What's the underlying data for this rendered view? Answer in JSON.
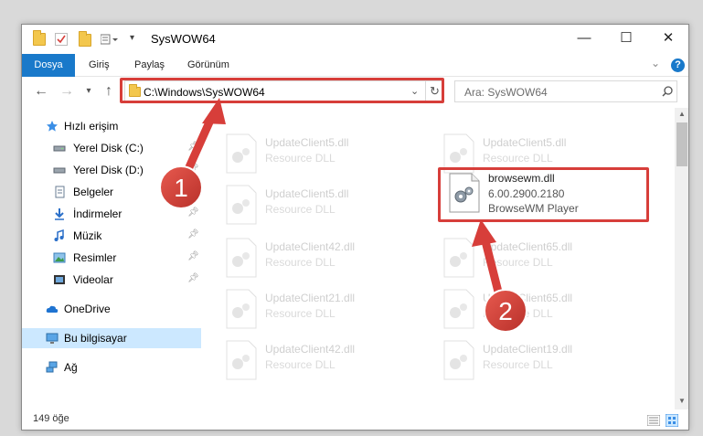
{
  "window": {
    "title": "SysWOW64",
    "minimize": "—",
    "maximize": "☐",
    "close": "✕"
  },
  "ribbon": {
    "tabs": [
      "Dosya",
      "Giriş",
      "Paylaş",
      "Görünüm"
    ],
    "expand": "⌄",
    "help": "?"
  },
  "address": {
    "path": "C:\\Windows\\SysWOW64",
    "search_placeholder": "Ara: SysWOW64"
  },
  "sidebar": {
    "quick_access": "Hızlı erişim",
    "items": [
      {
        "label": "Yerel Disk (C:)",
        "icon": "drive-icon"
      },
      {
        "label": "Yerel Disk (D:)",
        "icon": "drive-icon"
      },
      {
        "label": "Belgeler",
        "icon": "documents-icon"
      },
      {
        "label": "İndirmeler",
        "icon": "download-icon"
      },
      {
        "label": "Müzik",
        "icon": "music-icon"
      },
      {
        "label": "Resimler",
        "icon": "pictures-icon"
      },
      {
        "label": "Videolar",
        "icon": "videos-icon"
      }
    ],
    "onedrive": "OneDrive",
    "this_pc": "Bu bilgisayar",
    "network": "Ağ"
  },
  "files": [
    {
      "name": "UpdateClient5.dll",
      "sub": "Resource DLL"
    },
    {
      "name": "UpdateClient5.dll",
      "sub": "Resource DLL"
    },
    {
      "name": "UpdateClient5.dll",
      "sub": "Resource DLL"
    },
    {
      "name": "UpdateClient42.dll",
      "sub": "Resource DLL"
    },
    {
      "name": "UpdateClient65.dll",
      "sub": "Resource DLL"
    },
    {
      "name": "UpdateClient21.dll",
      "sub": "Resource DLL"
    },
    {
      "name": "UpdateClient65.dll",
      "sub": "Resource DLL"
    },
    {
      "name": "UpdateClient42.dll",
      "sub": "Resource DLL"
    },
    {
      "name": "UpdateClient19.dll",
      "sub": "Resource DLL"
    }
  ],
  "highlighted_file": {
    "name": "browsewm.dll",
    "version": "6.00.2900.2180",
    "description": "BrowseWM Player"
  },
  "annotations": {
    "step1": "1",
    "step2": "2",
    "highlight_color": "#d73e3a"
  },
  "status": {
    "count": "149 öğe"
  },
  "colors": {
    "accent": "#1979ca",
    "selected": "#cce8ff"
  }
}
